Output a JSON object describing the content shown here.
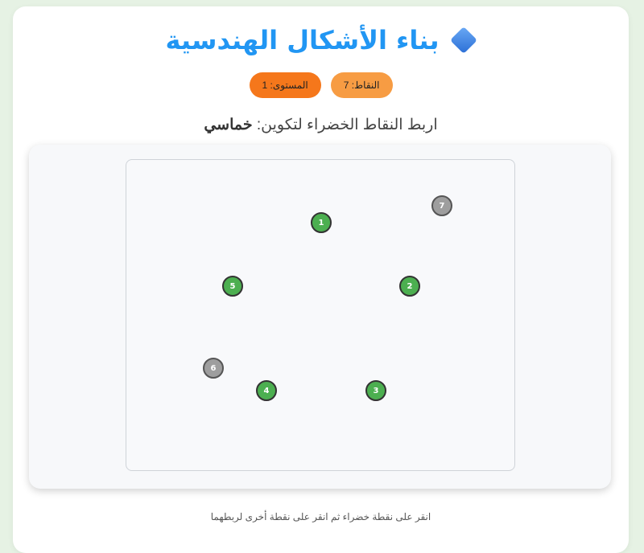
{
  "header": {
    "title": "بناء الأشكال الهندسية",
    "icon": "blue-diamond-icon"
  },
  "stats": {
    "score_label": "النقاط: 7",
    "level_label": "المستوى: 1"
  },
  "instruction": {
    "prefix": "اربط النقاط الخضراء لتكوين: ",
    "shape": "خماسي"
  },
  "board": {
    "points": [
      {
        "label": "1",
        "color": "green"
      },
      {
        "label": "2",
        "color": "green"
      },
      {
        "label": "3",
        "color": "green"
      },
      {
        "label": "4",
        "color": "green"
      },
      {
        "label": "5",
        "color": "green"
      },
      {
        "label": "6",
        "color": "gray"
      },
      {
        "label": "7",
        "color": "gray"
      }
    ]
  },
  "hint": "انقر على نقطة خضراء ثم انقر على نقطة أخرى لربطهما",
  "colors": {
    "title": "#2196f3",
    "green_point": "#4caf50",
    "gray_point": "#9e9e9e",
    "score_badge": "#f79c43",
    "level_badge": "#f5771b",
    "page_background": "#e6f2e4"
  }
}
